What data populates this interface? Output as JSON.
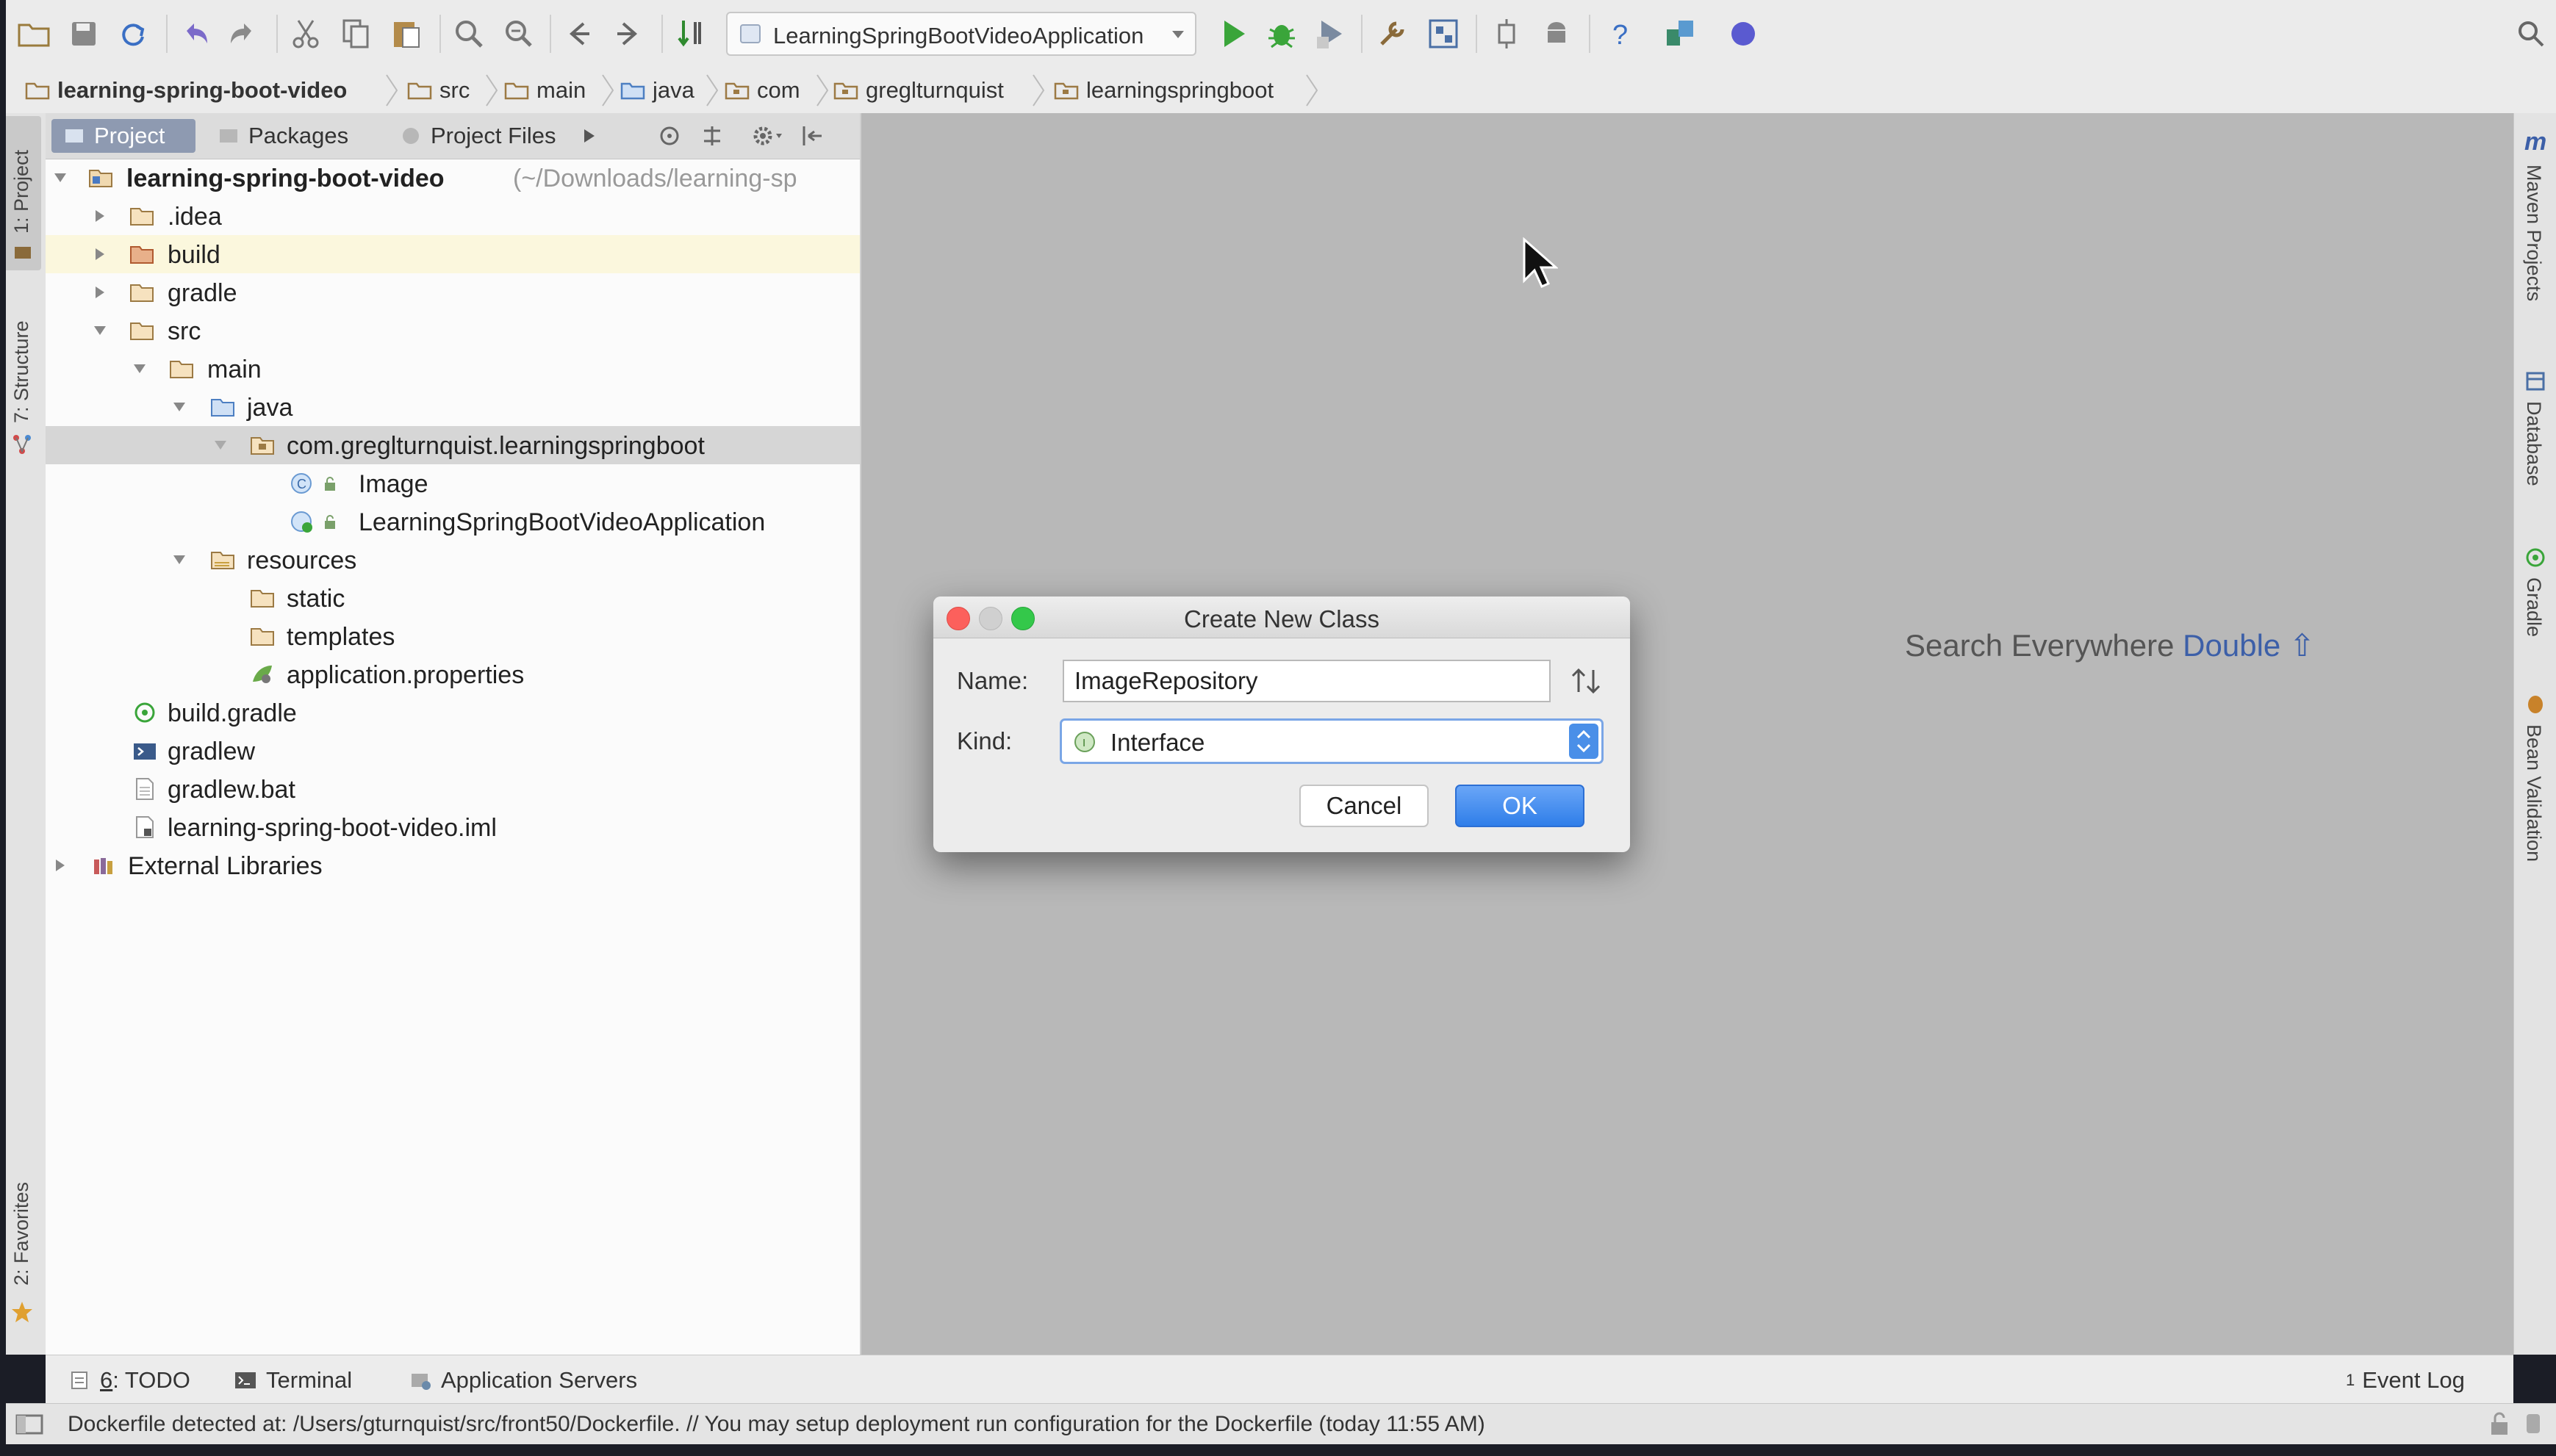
{
  "toolbar": {
    "run_config": "LearningSpringBootVideoApplication"
  },
  "breadcrumb": [
    {
      "label": "learning-spring-boot-video"
    },
    {
      "label": "src"
    },
    {
      "label": "main"
    },
    {
      "label": "java"
    },
    {
      "label": "com"
    },
    {
      "label": "greglturnquist"
    },
    {
      "label": "learningspringboot"
    }
  ],
  "left_strip": {
    "project": "1: Project",
    "structure": "7: Structure",
    "favorites": "2: Favorites"
  },
  "right_strip": {
    "maven": "Maven Projects",
    "database": "Database",
    "gradle": "Gradle",
    "bean": "Bean Validation"
  },
  "panel_tabs": {
    "project": "Project",
    "packages": "Packages",
    "project_files": "Project Files"
  },
  "tree": {
    "root": "learning-spring-boot-video",
    "root_path": "(~/Downloads/learning-sp",
    "idea": ".idea",
    "build": "build",
    "gradle": "gradle",
    "src": "src",
    "main": "main",
    "java": "java",
    "package": "com.greglturnquist.learningspringboot",
    "image": "Image",
    "app": "LearningSpringBootVideoApplication",
    "resources": "resources",
    "static": "static",
    "templates": "templates",
    "app_props": "application.properties",
    "build_gradle": "build.gradle",
    "gradlew": "gradlew",
    "gradlew_bat": "gradlew.bat",
    "iml": "learning-spring-boot-video.iml",
    "external": "External Libraries"
  },
  "editor": {
    "search_hint": "Search Everywhere",
    "search_key": "Double ⇧"
  },
  "dialog": {
    "title": "Create New Class",
    "name_label": "Name:",
    "name_value": "ImageRepository",
    "kind_label": "Kind:",
    "kind_value": "Interface",
    "kind_icon_letter": "I",
    "cancel": "Cancel",
    "ok": "OK"
  },
  "bottom_tabs": {
    "todo_num": "6",
    "todo_rest": ": TODO",
    "terminal": "Terminal",
    "app_servers": "Application Servers",
    "event_log": "Event Log",
    "event_count": "1"
  },
  "status": {
    "message": "Dockerfile detected at: /Users/gturnquist/src/front50/Dockerfile. // You may setup deployment run configuration for the Dockerfile (today 11:55 AM)"
  },
  "colors": {
    "accent_blue": "#2f7ee9",
    "selection_gray": "#d6d6d6",
    "highlight_yellow": "#fbf7dd",
    "folder_orange": "#d9a86c",
    "run_green": "#3aa53a",
    "close_red": "#fc605c",
    "maximize_green": "#34c84a"
  }
}
